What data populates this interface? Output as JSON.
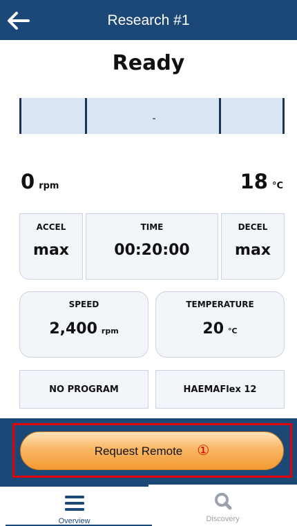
{
  "header": {
    "title": "Research #1",
    "back_icon": "arrow-left-icon"
  },
  "status": "Ready",
  "segment_bar": {
    "value": "-"
  },
  "current": {
    "speed_value": "0",
    "speed_unit": "rpm",
    "temp_value": "18",
    "temp_unit": "°C"
  },
  "params": {
    "accel": {
      "label": "ACCEL",
      "value": "max"
    },
    "time": {
      "label": "TIME",
      "value": "00:20:00"
    },
    "decel": {
      "label": "DECEL",
      "value": "max"
    },
    "speed": {
      "label": "SPEED",
      "value": "2,400",
      "unit": "rpm"
    },
    "temperature": {
      "label": "TEMPERATURE",
      "value": "20",
      "unit": "°C"
    }
  },
  "program": {
    "label": "NO PROGRAM"
  },
  "rotor": {
    "label": "HAEMAFlex 12"
  },
  "remote": {
    "label": "Request Remote",
    "marker": "①"
  },
  "tabs": [
    {
      "label": "Overview",
      "icon": "menu-icon",
      "active": true
    },
    {
      "label": "Discovery",
      "icon": "search-icon",
      "active": false
    }
  ],
  "colors": {
    "header": "#1c4877",
    "accent_orange": "#f49a33",
    "highlight_red": "#e40000",
    "card_bg": "#f2f5f9"
  }
}
